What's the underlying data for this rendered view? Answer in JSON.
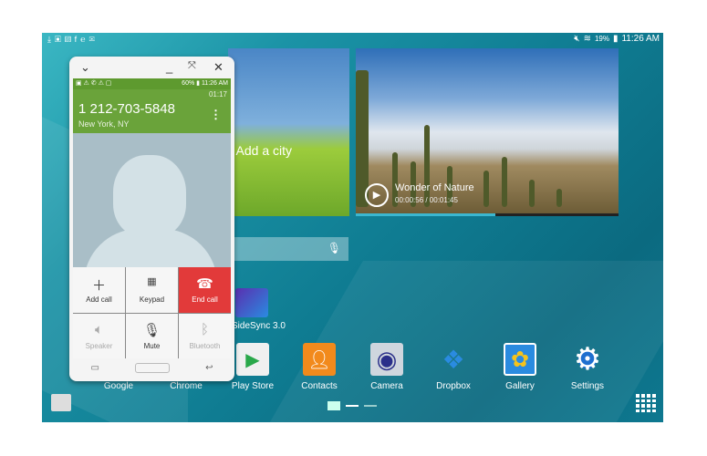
{
  "status_bar": {
    "left_icons": [
      "download-icon",
      "image-icon",
      "gallery-icon",
      "facebook-icon",
      "nyt-icon",
      "email-icon"
    ],
    "battery": "19%",
    "time": "11:26 AM"
  },
  "weather_widget": {
    "text": "Add a city"
  },
  "video_widget": {
    "title": "Wonder of Nature",
    "time": "00:00:56 / 00:01:45",
    "progress": 0.53,
    "accent": "#3bb7d0"
  },
  "search": {
    "mic_icon": "microphone-icon"
  },
  "apps": [
    {
      "label": "Google"
    },
    {
      "label": "Chrome"
    },
    {
      "label": "Play Store",
      "color": "#f0f0f0"
    },
    {
      "label": "Contacts",
      "color": "#f28a1c"
    },
    {
      "label": "Camera",
      "color": "#cfd6de"
    },
    {
      "label": "Dropbox",
      "color": "#2a8be0"
    },
    {
      "label": "Gallery",
      "color": "#f5c31c"
    },
    {
      "label": "Settings",
      "color": "#1f6fcf"
    }
  ],
  "sidesync": {
    "label": "SideSync 3.0"
  },
  "call_window": {
    "status": {
      "battery": "60%",
      "time": "11:26 AM"
    },
    "duration": "01:17",
    "number": "1 212-703-5848",
    "location": "New York, NY",
    "buttons": [
      {
        "label": "Add call",
        "icon": "plus-icon"
      },
      {
        "label": "Keypad",
        "icon": "keypad-icon"
      },
      {
        "label": "End call",
        "icon": "end-call-icon",
        "color": "#e23a3a"
      },
      {
        "label": "Speaker",
        "icon": "speaker-icon"
      },
      {
        "label": "Mute",
        "icon": "mute-icon"
      },
      {
        "label": "Bluetooth",
        "icon": "bluetooth-icon"
      }
    ]
  }
}
